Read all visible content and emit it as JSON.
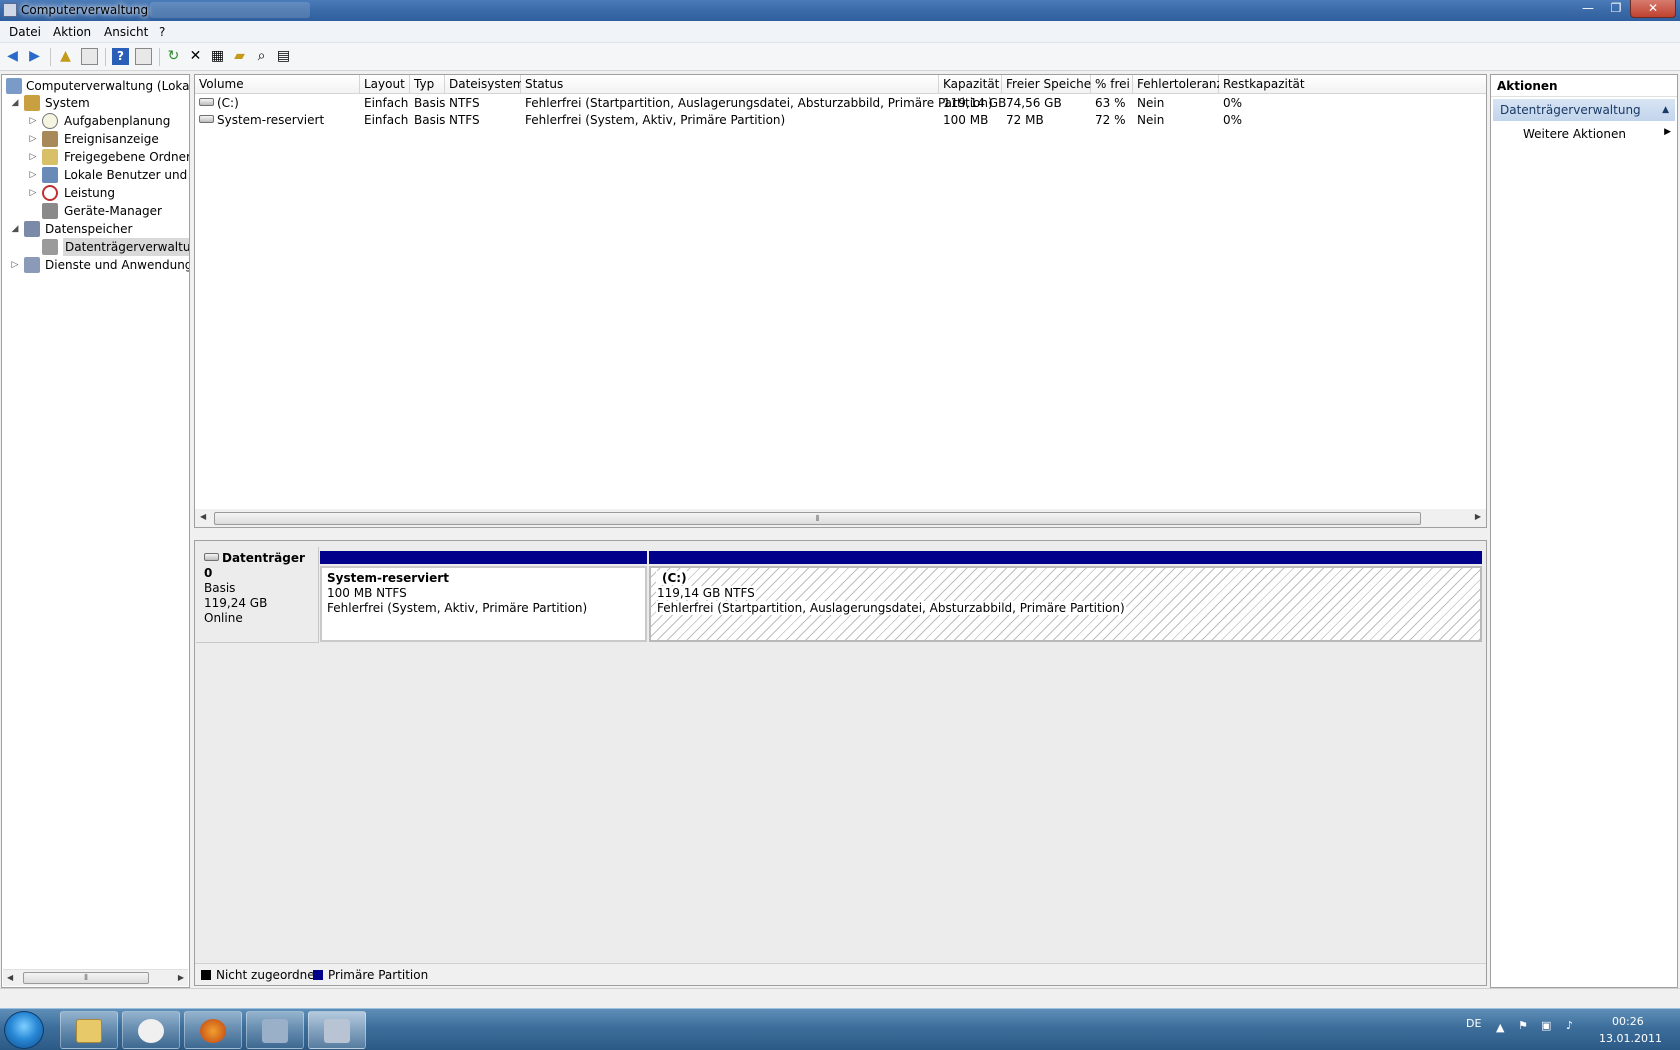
{
  "window": {
    "title": "Computerverwaltung",
    "controls": {
      "minimize": "—",
      "maximize": "❐",
      "close": "✕"
    }
  },
  "menu": [
    "Datei",
    "Aktion",
    "Ansicht",
    "?"
  ],
  "tree": {
    "root": "Computerverwaltung (Lokal)",
    "system": "System",
    "aufgaben": "Aufgabenplanung",
    "ereignis": "Ereignisanzeige",
    "freigegeben": "Freigegebene Ordner",
    "lokale": "Lokale Benutzer und Gruppen",
    "leistung": "Leistung",
    "geraete": "Geräte-Manager",
    "datenspeicher": "Datenspeicher",
    "datentraeger": "Datenträgerverwaltung",
    "dienste": "Dienste und Anwendungen"
  },
  "volumes": {
    "columns": [
      "Volume",
      "Layout",
      "Typ",
      "Dateisystem",
      "Status",
      "Kapazität",
      "Freier Speicher",
      "% frei",
      "Fehlertoleranz",
      "Restkapazität"
    ],
    "rows": [
      [
        "(C:)",
        "Einfach",
        "Basis",
        "NTFS",
        "Fehlerfrei (Startpartition, Auslagerungsdatei, Absturzabbild, Primäre Partition)",
        "119,14 GB",
        "74,56 GB",
        "63 %",
        "Nein",
        "0%"
      ],
      [
        "System-reserviert",
        "Einfach",
        "Basis",
        "NTFS",
        "Fehlerfrei (System, Aktiv, Primäre Partition)",
        "100 MB",
        "72 MB",
        "72 %",
        "Nein",
        "0%"
      ]
    ]
  },
  "disk": {
    "name": "Datenträger 0",
    "type": "Basis",
    "size": "119,24 GB",
    "state": "Online",
    "partitions": [
      {
        "name": "System-reserviert",
        "size": "100 MB NTFS",
        "status": "Fehlerfrei (System, Aktiv, Primäre Partition)"
      },
      {
        "name": "(C:)",
        "size": "119,14 GB NTFS",
        "status": "Fehlerfrei (Startpartition, Auslagerungsdatei, Absturzabbild, Primäre Partition)"
      }
    ]
  },
  "legend": {
    "unallocated": "Nicht zugeordnet",
    "primary": "Primäre Partition",
    "unallocated_color": "#000000",
    "primary_color": "#00008b"
  },
  "actions": {
    "header": "Aktionen",
    "section": "Datenträgerverwaltung",
    "more": "Weitere Aktionen"
  },
  "tray": {
    "lang": "DE",
    "time": "00:26",
    "date": "13.01.2011"
  }
}
